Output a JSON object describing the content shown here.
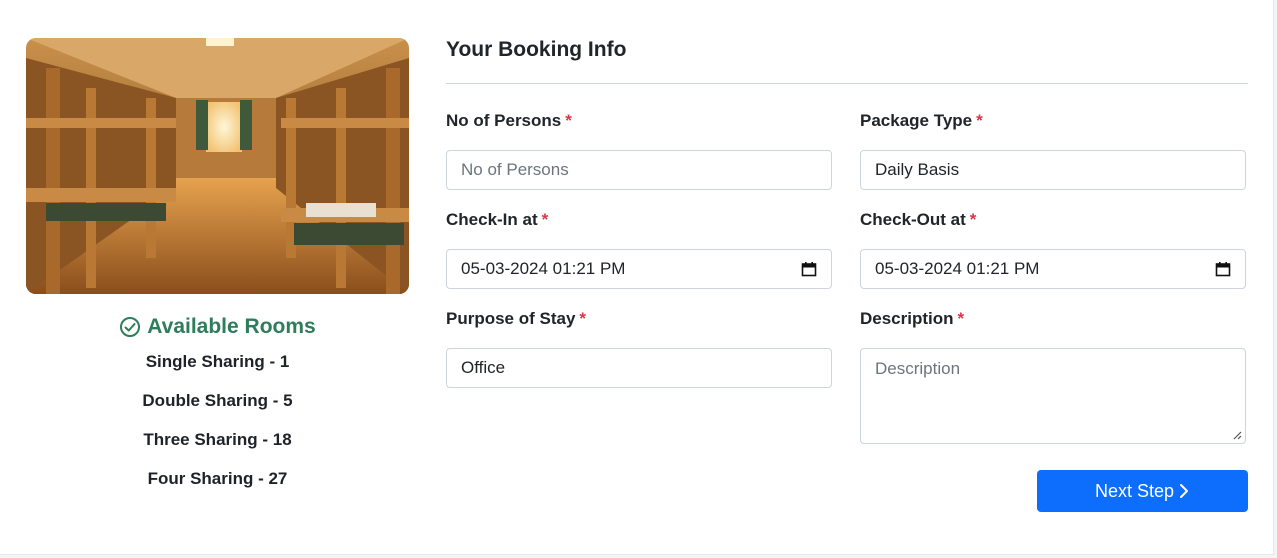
{
  "sidebar": {
    "image_alt": "Hostel room with bunk beds",
    "available_title": "Available Rooms",
    "rooms": [
      {
        "label": "Single Sharing - 1"
      },
      {
        "label": "Double Sharing - 5"
      },
      {
        "label": "Three Sharing - 18"
      },
      {
        "label": "Four Sharing - 27"
      }
    ]
  },
  "form": {
    "title": "Your Booking Info",
    "required_mark": "*",
    "persons": {
      "label": "No of Persons",
      "placeholder": "No of Persons",
      "value": ""
    },
    "package": {
      "label": "Package Type",
      "value": "Daily Basis"
    },
    "checkin": {
      "label": "Check-In at",
      "value": "05-03-2024 01:21 PM"
    },
    "checkout": {
      "label": "Check-Out at",
      "value": "05-03-2024 01:21 PM"
    },
    "purpose": {
      "label": "Purpose of Stay",
      "value": "Office"
    },
    "description": {
      "label": "Description",
      "placeholder": "Description",
      "value": ""
    },
    "next_label": "Next Step"
  },
  "colors": {
    "accent": "#0d6efd",
    "success": "#2e7d5b",
    "required": "#dc3545"
  },
  "icons": {
    "available": "check-circle-icon",
    "calendar": "calendar-icon",
    "next": "chevron-right-icon"
  }
}
